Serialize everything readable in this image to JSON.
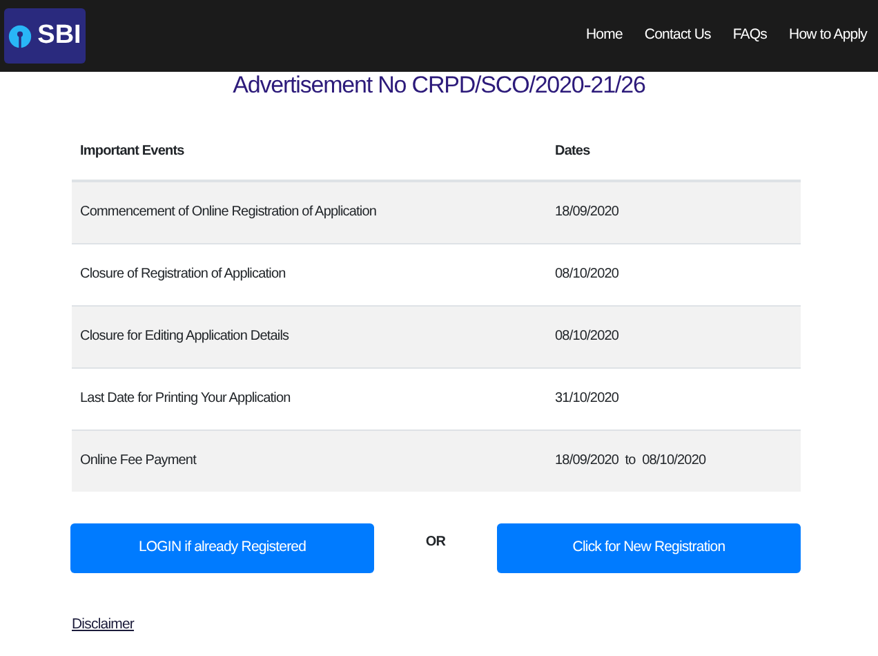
{
  "navbar": {
    "logo_text": "SBI",
    "links": [
      "Home",
      "Contact Us",
      "FAQs",
      "How to Apply"
    ]
  },
  "heading": "Advertisement No CRPD/SCO/2020-21/26",
  "table": {
    "columns": [
      "Important Events",
      "Dates"
    ],
    "rows": [
      [
        "Commencement of Online Registration of Application",
        "18/09/2020"
      ],
      [
        "Closure of Registration of Application",
        "08/10/2020"
      ],
      [
        "Closure for Editing Application Details",
        "08/10/2020"
      ],
      [
        "Last Date for Printing Your Application",
        "31/10/2020"
      ],
      [
        "Online Fee Payment",
        "18/09/2020  to  08/10/2020"
      ]
    ]
  },
  "buttons": {
    "login": "LOGIN if already Registered",
    "separator": "OR",
    "register": "Click for New Registration"
  },
  "footer_link": "Disclaimer"
}
